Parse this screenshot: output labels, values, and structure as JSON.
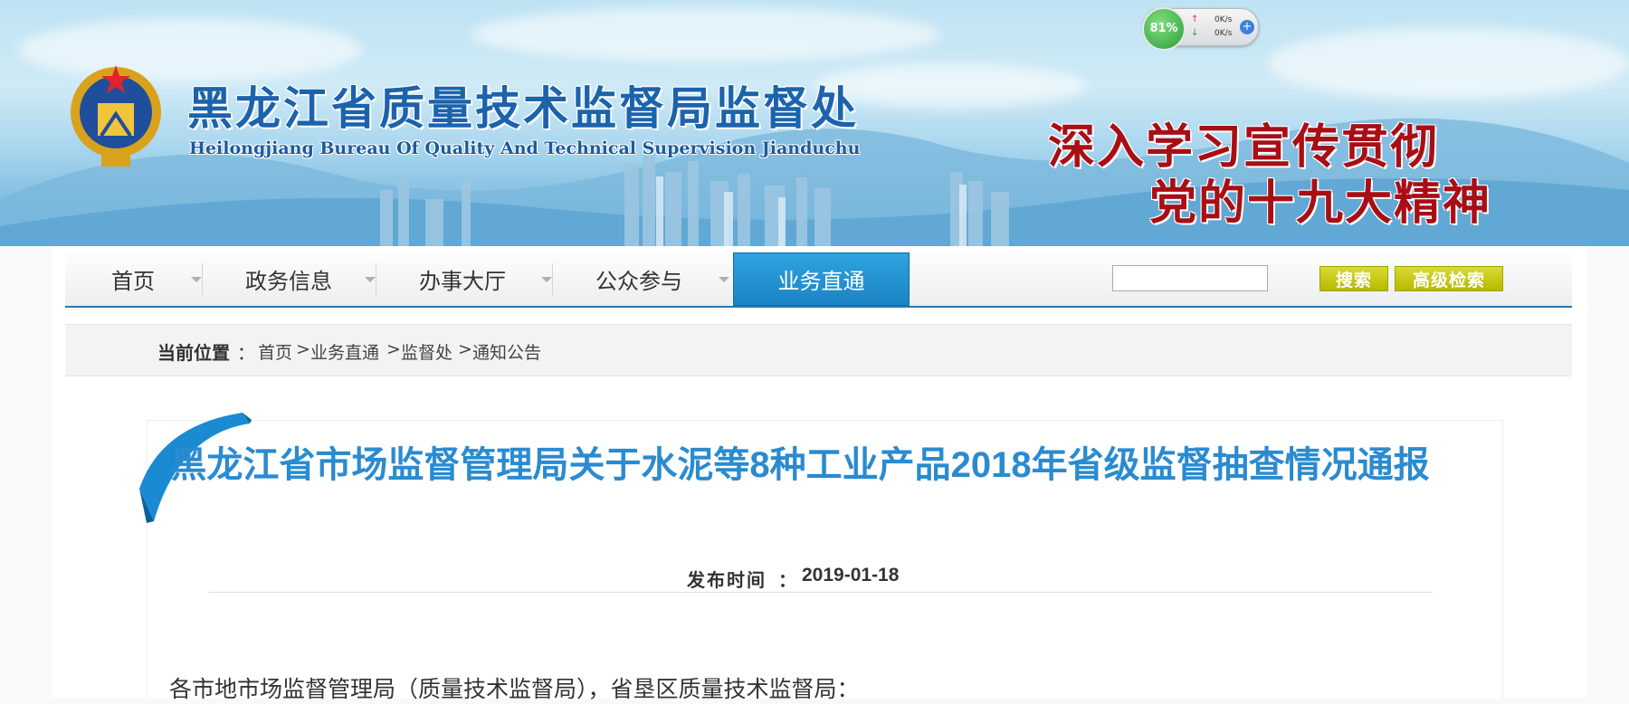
{
  "banner": {
    "title_cn": "黑龙江省质量技术监督局监督处",
    "title_en": "Heilongjiang Bureau Of Quality And Technical Supervision Jianduchu",
    "slogan_line1": "深入学习宣传贯彻",
    "slogan_line2": "党的十九大精神"
  },
  "net_widget": {
    "percent": "81%",
    "upload": "0K/s",
    "download": "0K/s",
    "plus": "+"
  },
  "nav": {
    "items": [
      {
        "label": "首页"
      },
      {
        "label": "政务信息"
      },
      {
        "label": "办事大厅"
      },
      {
        "label": "公众参与"
      },
      {
        "label": "业务直通"
      }
    ],
    "active_index": 4,
    "search_placeholder": "",
    "search_button": "搜索",
    "advanced_search_button": "高级检索"
  },
  "breadcrumb": {
    "label": "当前位置",
    "colon": "：",
    "items": [
      "首页",
      "业务直通",
      "监督处",
      "通知公告"
    ],
    "separator": ">"
  },
  "article": {
    "title": "黑龙江省市场监督管理局关于水泥等8种工业产品2018年省级监督抽查情况通报",
    "publish_label": "发布时间",
    "publish_colon": "：",
    "publish_date": "2019-01-18",
    "salutation": "各市地市场监督管理局（质量技术监督局），省垦区质量技术监督局："
  },
  "colors": {
    "nav_active": "#1a84c4",
    "title_blue": "#2a8bd0",
    "slogan_red": "#a80f15",
    "button_yellow": "#c6c912"
  },
  "icons": [
    "national-emblem-logo",
    "upload-arrow-icon",
    "download-arrow-icon",
    "plus-icon",
    "ribbon-decoration"
  ]
}
